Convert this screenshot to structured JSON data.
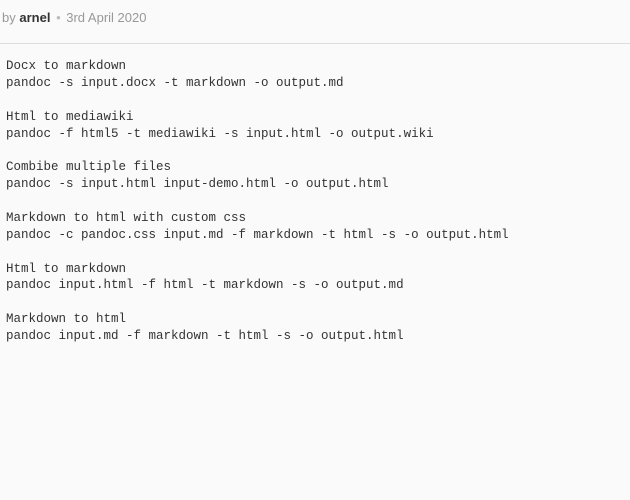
{
  "meta": {
    "by_label": "by",
    "author": "arnel",
    "separator": "•",
    "date": "3rd April 2020"
  },
  "code": "Docx to markdown\npandoc -s input.docx -t markdown -o output.md\n\nHtml to mediawiki\npandoc -f html5 -t mediawiki -s input.html -o output.wiki\n\nCombibe multiple files\npandoc -s input.html input-demo.html -o output.html\n\nMarkdown to html with custom css\npandoc -c pandoc.css input.md -f markdown -t html -s -o output.html\n\nHtml to markdown\npandoc input.html -f html -t markdown -s -o output.md\n\nMarkdown to html\npandoc input.md -f markdown -t html -s -o output.html"
}
